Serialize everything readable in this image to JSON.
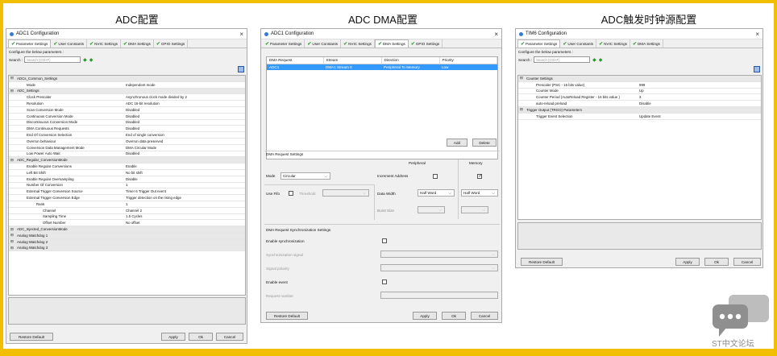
{
  "headers": {
    "adc": "ADC配置",
    "dma": "ADC DMA配置",
    "tim": "ADC触发时钟源配置"
  },
  "common": {
    "configure": "Configure the below parameters :",
    "search_label": "Search :",
    "search_placeholder": "Search (Ctrl+F)",
    "restore": "Restore Default",
    "apply": "Apply",
    "ok": "Ok",
    "cancel": "Cancel",
    "close": "×"
  },
  "adc_win": {
    "title": "ADC1 Configuration",
    "tabs": [
      "Parameter Settings",
      "User Constants",
      "NVIC Settings",
      "DMA Settings",
      "GPIO Settings"
    ],
    "rows": [
      {
        "k": "ADCs_Common_Settings",
        "v": "",
        "g": true
      },
      {
        "k": "Mode",
        "v": "Independent mode"
      },
      {
        "k": "ADC_Settings",
        "v": "",
        "g": true
      },
      {
        "k": "Clock Prescaler",
        "v": "Asynchronous clock mode divided by 2"
      },
      {
        "k": "Resolution",
        "v": "ADC 16-bit resolution"
      },
      {
        "k": "Scan Conversion Mode",
        "v": "Disabled"
      },
      {
        "k": "Continuous Conversion Mode",
        "v": "Disabled"
      },
      {
        "k": "Discontinuous Conversion Mode",
        "v": "Disabled"
      },
      {
        "k": "DMA Continuous Requests",
        "v": "Disabled"
      },
      {
        "k": "End Of Conversion Selection",
        "v": "End of single conversion"
      },
      {
        "k": "Overrun behaviour",
        "v": "Overrun data preserved"
      },
      {
        "k": "Conversion Data Management Mode",
        "v": "DMA Circular Mode"
      },
      {
        "k": "Low Power Auto Wait",
        "v": "Disabled"
      },
      {
        "k": "ADC_Regular_ConversionMode",
        "v": "",
        "g": true
      },
      {
        "k": "Enable Regular Conversions",
        "v": "Enable"
      },
      {
        "k": "Left Bit Shift",
        "v": "No bit shift"
      },
      {
        "k": "Enable Regular Oversampling",
        "v": "Disable"
      },
      {
        "k": "Number Of Conversion",
        "v": "1"
      },
      {
        "k": "External Trigger Conversion Source",
        "v": "Timer 6 Trigger Out event"
      },
      {
        "k": "External Trigger Conversion Edge",
        "v": "Trigger detection on the rising edge"
      },
      {
        "k": "Rank",
        "v": "1"
      },
      {
        "k": "Channel",
        "v": "Channel 2"
      },
      {
        "k": "Sampling Time",
        "v": "1.5 Cycles"
      },
      {
        "k": "Offset Number",
        "v": "No offset"
      },
      {
        "k": "ADC_Injected_ConversionMode",
        "v": "",
        "g": true
      },
      {
        "k": "Analog Watchdog 1",
        "v": "",
        "g": true
      },
      {
        "k": "Analog Watchdog 2",
        "v": "",
        "g": true
      },
      {
        "k": "Analog Watchdog 3",
        "v": "",
        "g": true
      }
    ]
  },
  "dma_win": {
    "title": "ADC1 Configuration",
    "tabs": [
      "Parameter Settings",
      "User Constants",
      "NVIC Settings",
      "DMA Settings",
      "GPIO Settings"
    ],
    "cols": [
      "DMA Request",
      "Stream",
      "Direction",
      "Priority"
    ],
    "row": [
      "ADC1",
      "DMA1 Stream 0",
      "Peripheral To Memory",
      "Low"
    ],
    "add": "Add",
    "delete": "Delete",
    "req_settings": "DMA Request Settings",
    "peripheral": "Peripheral",
    "memory": "Memory",
    "mode_label": "Mode",
    "mode_value": "Circular",
    "inc_addr": "Increment Address",
    "use_fifo": "Use Fifo",
    "threshold": "Threshold",
    "data_width": "Data Width",
    "dw_periph": "Half Word",
    "dw_mem": "Half Word",
    "burst": "Burst Size",
    "sync_settings": "DMA Request Synchronization Settings",
    "enable_sync": "Enable synchronization",
    "sync_signal": "Synchronization signal",
    "signal_polarity": "Signal polarity",
    "enable_event": "Enable event",
    "request_number": "Request number"
  },
  "tim_win": {
    "title": "TIM6 Configuration",
    "tabs": [
      "Parameter Settings",
      "User Constants",
      "NVIC Settings",
      "DMA Settings"
    ],
    "rows": [
      {
        "k": "Counter Settings",
        "v": "",
        "g": true
      },
      {
        "k": "Prescaler (PSC - 16 bits value)",
        "v": "999"
      },
      {
        "k": "Counter Mode",
        "v": "Up"
      },
      {
        "k": "Counter Period (AutoReload Register - 16 bits value )",
        "v": "3"
      },
      {
        "k": "auto-reload preload",
        "v": "Disable"
      },
      {
        "k": "Trigger Output (TRGO) Parameters",
        "v": "",
        "g": true
      },
      {
        "k": "Trigger Event Selection",
        "v": "Update Event"
      }
    ]
  },
  "watermark": "ST中文论坛"
}
